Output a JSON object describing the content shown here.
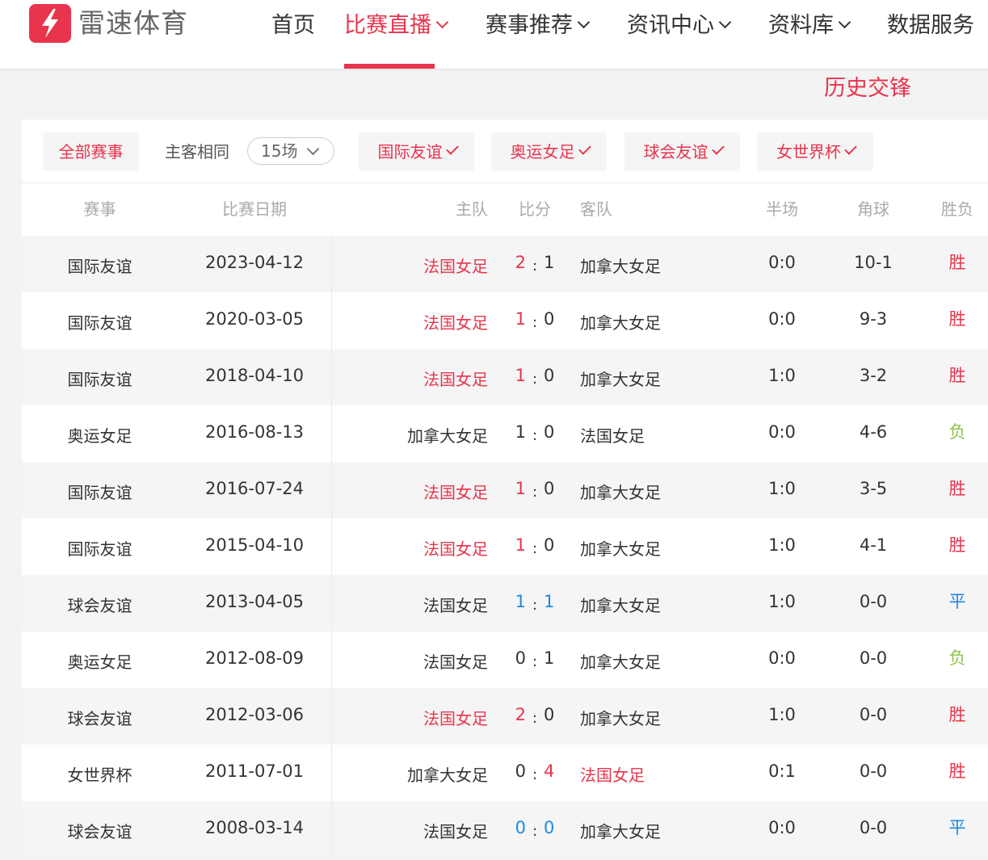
{
  "header": {
    "logo_text": "雷速体育",
    "nav": [
      {
        "label": "首页",
        "dropdown": false,
        "active": false
      },
      {
        "label": "比赛直播",
        "dropdown": true,
        "active": true
      },
      {
        "label": "赛事推荐",
        "dropdown": true,
        "active": false
      },
      {
        "label": "资讯中心",
        "dropdown": true,
        "active": false
      },
      {
        "label": "资料库",
        "dropdown": true,
        "active": false
      },
      {
        "label": "数据服务",
        "dropdown": false,
        "active": false
      }
    ]
  },
  "section_title": "历史交锋",
  "filters": {
    "all_label": "全部赛事",
    "same_home_away_label": "主客相同",
    "count_value": "15场",
    "leagues": [
      "国际友谊",
      "奥运女足",
      "球会友谊",
      "女世界杯"
    ]
  },
  "table": {
    "headers": {
      "league": "赛事",
      "date": "比赛日期",
      "home": "主队",
      "score": "比分",
      "away": "客队",
      "half": "半场",
      "corner": "角球",
      "result": "胜负"
    },
    "rows": [
      {
        "league": "国际友谊",
        "date": "2023-04-12",
        "home": "法国女足",
        "home_hl": true,
        "hs": "2",
        "as": "1",
        "hs_color": "red",
        "as_color": "",
        "away": "加拿大女足",
        "away_hl": false,
        "half": "0:0",
        "corner": "10-1",
        "result": "胜",
        "result_color": "red"
      },
      {
        "league": "国际友谊",
        "date": "2020-03-05",
        "home": "法国女足",
        "home_hl": true,
        "hs": "1",
        "as": "0",
        "hs_color": "red",
        "as_color": "",
        "away": "加拿大女足",
        "away_hl": false,
        "half": "0:0",
        "corner": "9-3",
        "result": "胜",
        "result_color": "red"
      },
      {
        "league": "国际友谊",
        "date": "2018-04-10",
        "home": "法国女足",
        "home_hl": true,
        "hs": "1",
        "as": "0",
        "hs_color": "red",
        "as_color": "",
        "away": "加拿大女足",
        "away_hl": false,
        "half": "1:0",
        "corner": "3-2",
        "result": "胜",
        "result_color": "red"
      },
      {
        "league": "奥运女足",
        "date": "2016-08-13",
        "home": "加拿大女足",
        "home_hl": false,
        "hs": "1",
        "as": "0",
        "hs_color": "",
        "as_color": "",
        "away": "法国女足",
        "away_hl": false,
        "half": "0:0",
        "corner": "4-6",
        "result": "负",
        "result_color": "green"
      },
      {
        "league": "国际友谊",
        "date": "2016-07-24",
        "home": "法国女足",
        "home_hl": true,
        "hs": "1",
        "as": "0",
        "hs_color": "red",
        "as_color": "",
        "away": "加拿大女足",
        "away_hl": false,
        "half": "1:0",
        "corner": "3-5",
        "result": "胜",
        "result_color": "red"
      },
      {
        "league": "国际友谊",
        "date": "2015-04-10",
        "home": "法国女足",
        "home_hl": true,
        "hs": "1",
        "as": "0",
        "hs_color": "red",
        "as_color": "",
        "away": "加拿大女足",
        "away_hl": false,
        "half": "1:0",
        "corner": "4-1",
        "result": "胜",
        "result_color": "red"
      },
      {
        "league": "球会友谊",
        "date": "2013-04-05",
        "home": "法国女足",
        "home_hl": false,
        "hs": "1",
        "as": "1",
        "hs_color": "blue",
        "as_color": "blue",
        "away": "加拿大女足",
        "away_hl": false,
        "half": "1:0",
        "corner": "0-0",
        "result": "平",
        "result_color": "blue"
      },
      {
        "league": "奥运女足",
        "date": "2012-08-09",
        "home": "法国女足",
        "home_hl": false,
        "hs": "0",
        "as": "1",
        "hs_color": "",
        "as_color": "",
        "away": "加拿大女足",
        "away_hl": false,
        "half": "0:0",
        "corner": "0-0",
        "result": "负",
        "result_color": "green"
      },
      {
        "league": "球会友谊",
        "date": "2012-03-06",
        "home": "法国女足",
        "home_hl": true,
        "hs": "2",
        "as": "0",
        "hs_color": "red",
        "as_color": "",
        "away": "加拿大女足",
        "away_hl": false,
        "half": "1:0",
        "corner": "0-0",
        "result": "胜",
        "result_color": "red"
      },
      {
        "league": "女世界杯",
        "date": "2011-07-01",
        "home": "加拿大女足",
        "home_hl": false,
        "hs": "0",
        "as": "4",
        "hs_color": "",
        "as_color": "red",
        "away": "法国女足",
        "away_hl": true,
        "half": "0:1",
        "corner": "0-0",
        "result": "胜",
        "result_color": "red"
      },
      {
        "league": "球会友谊",
        "date": "2008-03-14",
        "home": "法国女足",
        "home_hl": false,
        "hs": "0",
        "as": "0",
        "hs_color": "blue",
        "as_color": "blue",
        "away": "加拿大女足",
        "away_hl": false,
        "half": "0:0",
        "corner": "0-0",
        "result": "平",
        "result_color": "blue"
      }
    ]
  },
  "colors": {
    "accent": "#e8344c",
    "draw": "#1e88e5",
    "loss": "#8bc34a"
  }
}
